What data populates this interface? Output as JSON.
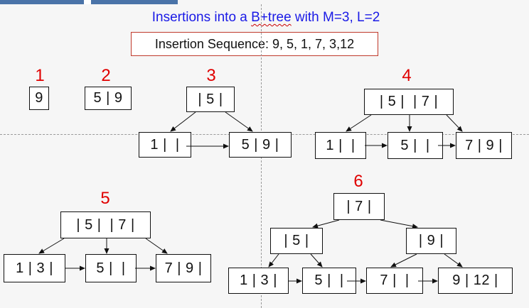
{
  "title": {
    "before": "Insertions into a ",
    "squiggly": "B+tree",
    "after": " with M=3, L=2"
  },
  "sequence": "Insertion Sequence: 9, 5, 1, 7, 3,12",
  "steps": [
    {
      "label": "1",
      "nodes": [
        {
          "id": "s1-root",
          "text": "9"
        }
      ]
    },
    {
      "label": "2",
      "nodes": [
        {
          "id": "s2-root",
          "text": "5 | 9"
        }
      ]
    },
    {
      "label": "3",
      "nodes": [
        {
          "id": "s3-root",
          "text": "| 5 |"
        },
        {
          "id": "s3-leaf-a",
          "text": "1 |  |"
        },
        {
          "id": "s3-leaf-b",
          "text": "5 | 9 |"
        }
      ]
    },
    {
      "label": "4",
      "nodes": [
        {
          "id": "s4-root",
          "text": "| 5 |  | 7 |"
        },
        {
          "id": "s4-leaf-a",
          "text": "1 |  |"
        },
        {
          "id": "s4-leaf-b",
          "text": "5 |  |"
        },
        {
          "id": "s4-leaf-c",
          "text": "7 | 9 |"
        }
      ]
    },
    {
      "label": "5",
      "nodes": [
        {
          "id": "s5-root",
          "text": "| 5 |  | 7 |"
        },
        {
          "id": "s5-leaf-a",
          "text": "1 | 3 |"
        },
        {
          "id": "s5-leaf-b",
          "text": "5 |  |"
        },
        {
          "id": "s5-leaf-c",
          "text": "7 | 9 |"
        }
      ]
    },
    {
      "label": "6",
      "nodes": [
        {
          "id": "s6-root",
          "text": "| 7 |"
        },
        {
          "id": "s6-inner-a",
          "text": "| 5 |"
        },
        {
          "id": "s6-inner-b",
          "text": "| 9 |"
        },
        {
          "id": "s6-leaf-a",
          "text": "1 | 3 |"
        },
        {
          "id": "s6-leaf-b",
          "text": "5 |  |"
        },
        {
          "id": "s6-leaf-c",
          "text": "7 |  |"
        },
        {
          "id": "s6-leaf-d",
          "text": "9 | 12 |"
        }
      ]
    }
  ]
}
